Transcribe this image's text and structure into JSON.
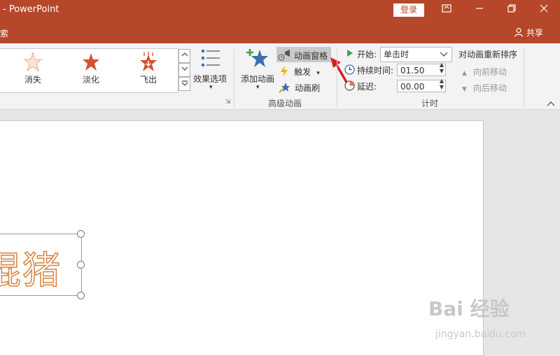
{
  "app": {
    "title": "- PowerPoint",
    "login_label": "登录",
    "search_fragment": "搜索",
    "share_label": "共享"
  },
  "window_controls": [
    "restore-ribbon",
    "minimize",
    "maximize",
    "close"
  ],
  "animations": [
    {
      "label": "消失",
      "icon": "disappear-star-icon"
    },
    {
      "label": "淡化",
      "icon": "fade-star-icon"
    },
    {
      "label": "飞出",
      "icon": "fly-out-star-icon"
    }
  ],
  "ribbon": {
    "effect_options": "效果选项",
    "add_animation": "添加动画",
    "animation_pane": "动画窗格",
    "trigger": "触发",
    "painter": "动画刷",
    "advanced_group": "高级动画",
    "start_label": "开始:",
    "start_value": "单击时",
    "duration_label": "持续时间:",
    "duration_value": "01.50",
    "delay_label": "延迟:",
    "delay_value": "00.00",
    "timing_group": "计时",
    "reorder_label": "对动画重新排序",
    "move_earlier": "向前移动",
    "move_later": "向后移动"
  },
  "slide": {
    "text": "琨猪"
  },
  "watermark": {
    "brand": "Bai 经验",
    "url": "jingyan.baidu.com"
  },
  "colors": {
    "accent": "#b7472a",
    "text_outline": "#d8833c",
    "star_orange": "#d35230",
    "star_blue": "#3e6fb0"
  }
}
